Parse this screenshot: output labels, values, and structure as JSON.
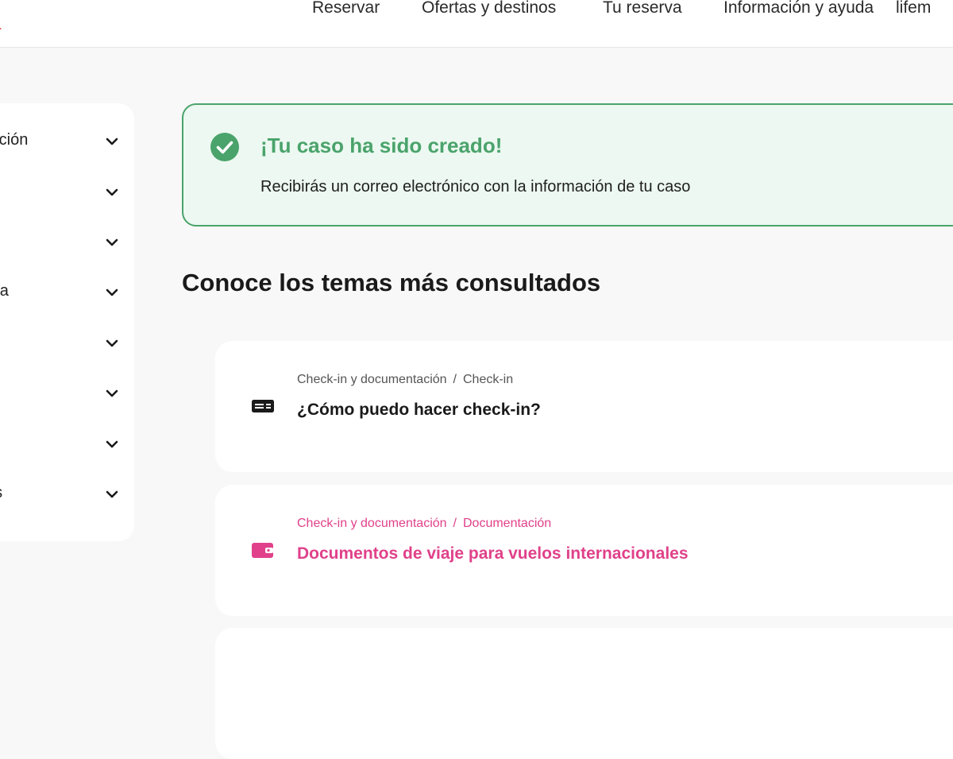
{
  "header": {
    "nav": [
      "Reservar",
      "Ofertas y destinos",
      "Tu reserva",
      "Información y ayuda",
      "lifem"
    ]
  },
  "sidebar": {
    "items": [
      {
        "label": "tación"
      },
      {
        "label": ""
      },
      {
        "label": ""
      },
      {
        "label": "ora"
      },
      {
        "label": ""
      },
      {
        "label": ""
      },
      {
        "label": ""
      },
      {
        "label": "os"
      }
    ]
  },
  "banner": {
    "title": "¡Tu caso ha sido creado!",
    "text": "Recibirás un correo electrónico con la información de tu caso",
    "icon": "check-circle-icon",
    "color": "#4aa36b"
  },
  "section": {
    "title": "Conoce los temas más consultados"
  },
  "cards": [
    {
      "crumb_1": "Check-in y documentación",
      "separator": "/",
      "crumb_2": "Check-in",
      "title": "¿Cómo puedo hacer check-in?",
      "icon": "ticket-icon"
    },
    {
      "crumb_1": "Check-in y documentación",
      "separator": "/",
      "crumb_2": "Documentación",
      "title": "Documentos de viaje para vuelos internacionales",
      "icon": "wallet-icon",
      "color": "#e0418a"
    }
  ]
}
